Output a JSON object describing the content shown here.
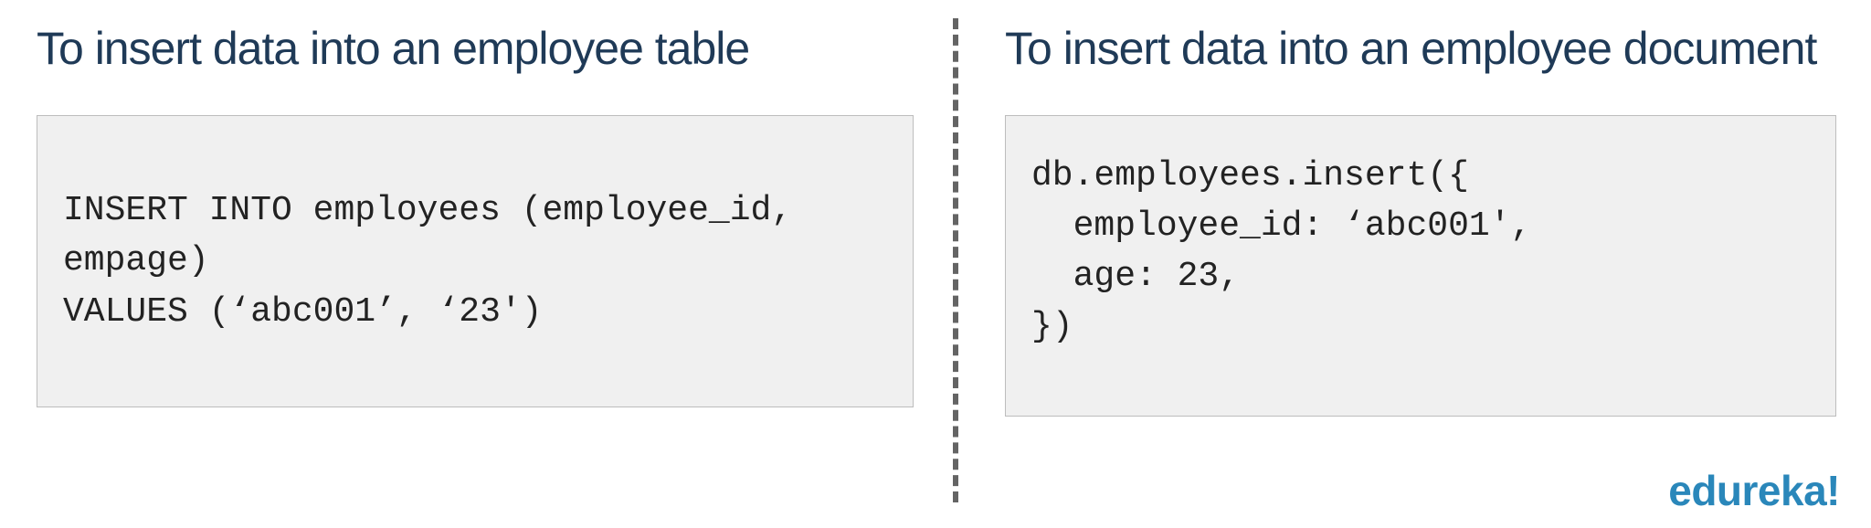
{
  "left": {
    "heading": "To insert data into an employee table",
    "code": [
      "INSERT INTO employees (employee_id,",
      "empage)",
      "VALUES (‘abc001’, ‘23')"
    ]
  },
  "right": {
    "heading": "To insert data into an employee document",
    "code": [
      "db.employees.insert({",
      "  employee_id: ‘abc001',",
      "  age: 23,",
      "})"
    ]
  },
  "brand": "edureka!"
}
